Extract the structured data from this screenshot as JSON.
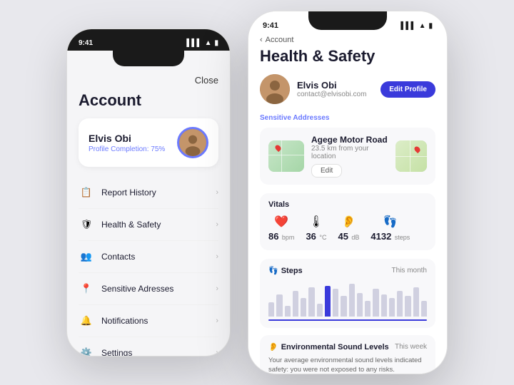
{
  "left_phone": {
    "status_time": "9:41",
    "close_label": "Close",
    "account_title": "Account",
    "user": {
      "name": "Elvis Obi",
      "profile_completion": "Profile Completion: 75%"
    },
    "menu_items": [
      {
        "id": "report-history",
        "icon": "📋",
        "label": "Report History"
      },
      {
        "id": "health-safety",
        "icon": "🛡",
        "label": "Health & Safety"
      },
      {
        "id": "contacts",
        "icon": "👥",
        "label": "Contacts"
      },
      {
        "id": "sensitive-addresses",
        "icon": "📍",
        "label": "Sensitive Adresses"
      },
      {
        "id": "notifications",
        "icon": "🔔",
        "label": "Notifications"
      },
      {
        "id": "settings",
        "icon": "⚙️",
        "label": "Settings"
      }
    ]
  },
  "right_phone": {
    "status_time": "9:41",
    "back_label": "Account",
    "page_title": "Health & Safety",
    "user": {
      "name": "Elvis Obi",
      "email": "contact@elvisobi.com"
    },
    "edit_profile_label": "Edit Profile",
    "sensitive_addresses_label": "Sensitive Addresses",
    "address": {
      "name": "Agege Motor Road",
      "distance": "23.5 km from your location",
      "edit_label": "Edit"
    },
    "vitals_label": "Vitals",
    "vitals": [
      {
        "icon": "❤️",
        "value": "86",
        "unit": "bpm"
      },
      {
        "icon": "🌡",
        "value": "36",
        "unit": "°C"
      },
      {
        "icon": "👂",
        "value": "45",
        "unit": "dB"
      },
      {
        "icon": "👣",
        "value": "4132",
        "unit": "steps"
      }
    ],
    "steps_label": "Steps",
    "steps_foot_icon": "👣",
    "this_month_label": "This month",
    "bar_heights": [
      20,
      30,
      15,
      35,
      25,
      40,
      18,
      42,
      38,
      28,
      45,
      32,
      22,
      38,
      30,
      25,
      35,
      28,
      40,
      22
    ],
    "sound_label": "Environmental Sound Levels",
    "sound_icon": "👂",
    "this_week_label": "This week",
    "sound_desc": "Your average environmental sound levels indicated safety: you were not exposed to any risks."
  }
}
